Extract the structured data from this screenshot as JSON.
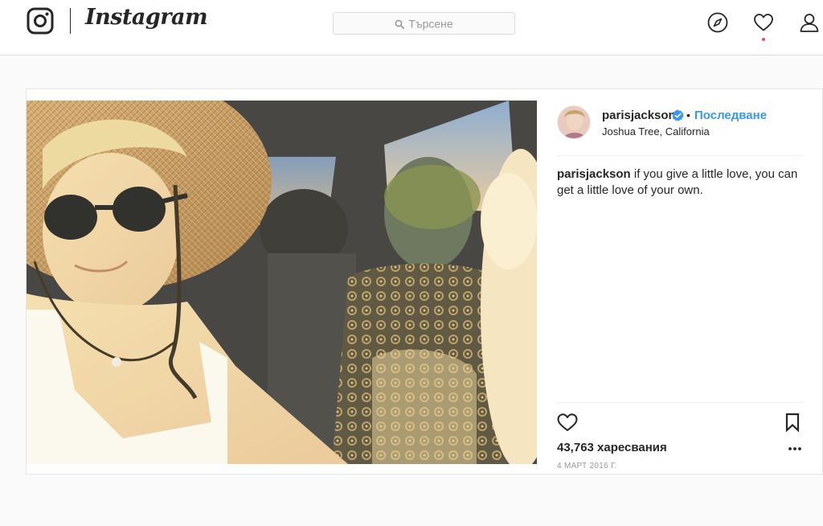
{
  "header": {
    "brand": "Instagram",
    "search_placeholder": "Търсене",
    "icons": [
      "instagram-logo-icon",
      "search-icon",
      "compass-icon",
      "heart-icon",
      "profile-icon"
    ],
    "notification_dot_color": "#ed4956"
  },
  "post": {
    "username": "parisjackson",
    "verified": true,
    "separator": "•",
    "follow_label": "Последване",
    "location": "Joshua Tree, California",
    "caption_user": "parisjackson",
    "caption_text": " if you give a little love, you can get a little love of your own.",
    "likes": "43,763 харесвания",
    "date": "4 МАРТ 2016 Г.",
    "icons": [
      "like-heart-icon",
      "bookmark-icon",
      "more-options-icon",
      "verified-badge-icon"
    ]
  },
  "colors": {
    "link_blue": "#3897f0",
    "text": "#262626",
    "muted": "#999999",
    "background": "#fafafa",
    "border": "#dbdbdb"
  }
}
